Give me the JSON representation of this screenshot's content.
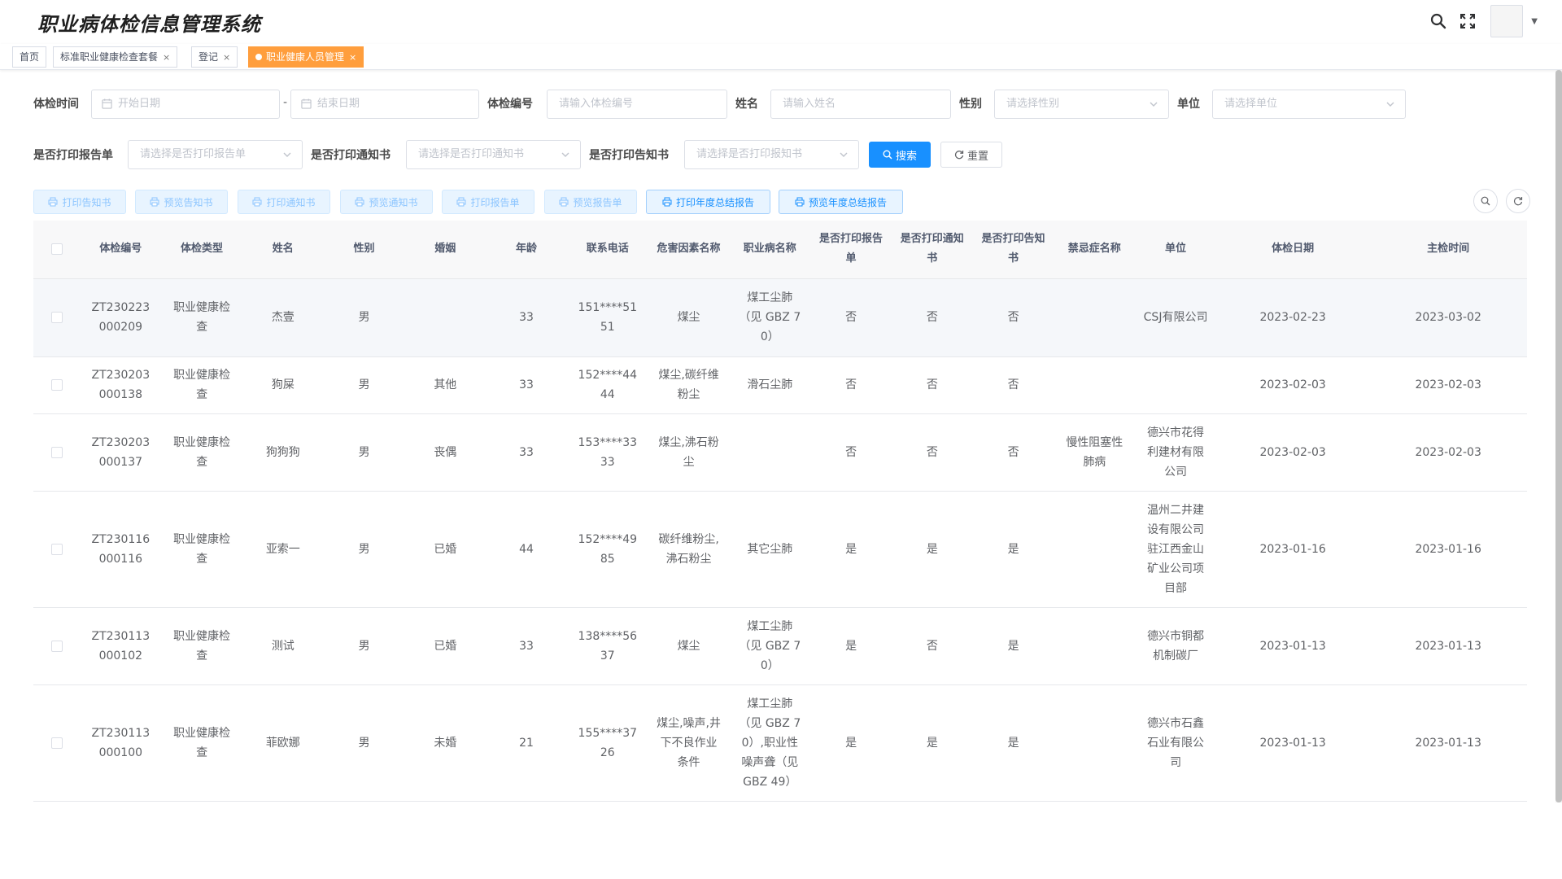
{
  "app": {
    "title": "职业病体检信息管理系统"
  },
  "header": {
    "icons": [
      "search-icon",
      "fullscreen-icon",
      "avatar",
      "chevron-down-icon"
    ]
  },
  "tags": [
    {
      "label": "首页",
      "closable": false,
      "active": false
    },
    {
      "label": "标准职业健康检查套餐",
      "closable": true,
      "active": false
    },
    {
      "label": "登记",
      "closable": true,
      "active": false
    },
    {
      "label": "职业健康人员管理",
      "closable": true,
      "active": true
    }
  ],
  "close_glyph": "×",
  "form": {
    "exam_time_label": "体检时间",
    "start_date_placeholder": "开始日期",
    "date_separator": "-",
    "end_date_placeholder": "结束日期",
    "exam_no_label": "体检编号",
    "exam_no_placeholder": "请输入体检编号",
    "name_label": "姓名",
    "name_placeholder": "请输入姓名",
    "gender_label": "性别",
    "gender_placeholder": "请选择性别",
    "unit_label": "单位",
    "unit_placeholder": "请选择单位",
    "print_report_label": "是否打印报告单",
    "print_report_placeholder": "请选择是否打印报告单",
    "print_notice_label": "是否打印通知书",
    "print_notice_placeholder": "请选择是否打印通知书",
    "print_inform_label": "是否打印告知书",
    "print_inform_placeholder": "请选择是否打印报知书",
    "search_button": "搜索",
    "reset_button": "重置"
  },
  "toolbar": {
    "buttons": [
      {
        "label": "打印告知书",
        "enabled": false
      },
      {
        "label": "预览告知书",
        "enabled": false
      },
      {
        "label": "打印通知书",
        "enabled": false
      },
      {
        "label": "预览通知书",
        "enabled": false
      },
      {
        "label": "打印报告单",
        "enabled": false
      },
      {
        "label": "预览报告单",
        "enabled": false
      },
      {
        "label": "打印年度总结报告",
        "enabled": true
      },
      {
        "label": "预览年度总结报告",
        "enabled": true
      }
    ]
  },
  "table": {
    "columns": [
      "体检编号",
      "体检类型",
      "姓名",
      "性别",
      "婚姻",
      "年龄",
      "联系电话",
      "危害因素名称",
      "职业病名称",
      "是否打印报告单",
      "是否打印通知书",
      "是否打印告知书",
      "禁忌症名称",
      "单位",
      "体检日期",
      "主检时间"
    ],
    "rows": [
      [
        "ZT230223000209",
        "职业健康检查",
        "杰壹",
        "男",
        "",
        "33",
        "151****5151",
        "煤尘",
        "煤工尘肺（见 GBZ 70）",
        "否",
        "否",
        "否",
        "",
        "CSJ有限公司",
        "2023-02-23",
        "2023-03-02"
      ],
      [
        "ZT230203000138",
        "职业健康检查",
        "狗屎",
        "男",
        "其他",
        "33",
        "152****4444",
        "煤尘,碳纤维粉尘",
        "滑石尘肺",
        "否",
        "否",
        "否",
        "",
        "",
        "2023-02-03",
        "2023-02-03"
      ],
      [
        "ZT230203000137",
        "职业健康检查",
        "狗狗狗",
        "男",
        "丧偶",
        "33",
        "153****3333",
        "煤尘,沸石粉尘",
        "",
        "否",
        "否",
        "否",
        "慢性阻塞性肺病",
        "德兴市花得利建材有限公司",
        "2023-02-03",
        "2023-02-03"
      ],
      [
        "ZT230116000116",
        "职业健康检查",
        "亚索一",
        "男",
        "已婚",
        "44",
        "152****4985",
        "碳纤维粉尘,沸石粉尘",
        "其它尘肺",
        "是",
        "是",
        "是",
        "",
        "温州二井建设有限公司驻江西金山矿业公司项目部",
        "2023-01-16",
        "2023-01-16"
      ],
      [
        "ZT230113000102",
        "职业健康检查",
        "测试",
        "男",
        "已婚",
        "33",
        "138****5637",
        "煤尘",
        "煤工尘肺（见 GBZ 70）",
        "是",
        "否",
        "是",
        "",
        "德兴市铜都机制碳厂",
        "2023-01-13",
        "2023-01-13"
      ],
      [
        "ZT230113000100",
        "职业健康检查",
        "菲欧娜",
        "男",
        "未婚",
        "21",
        "155****3726",
        "煤尘,噪声,井下不良作业条件",
        "煤工尘肺（见 GBZ 70）,职业性噪声聋（见 GBZ 49）",
        "是",
        "是",
        "是",
        "",
        "德兴市石鑫石业有限公司",
        "2023-01-13",
        "2023-01-13"
      ]
    ]
  },
  "colors": {
    "primary": "#1890ff",
    "active_tag": "#ff9e3d",
    "row_highlight": "#f5f7fa"
  }
}
